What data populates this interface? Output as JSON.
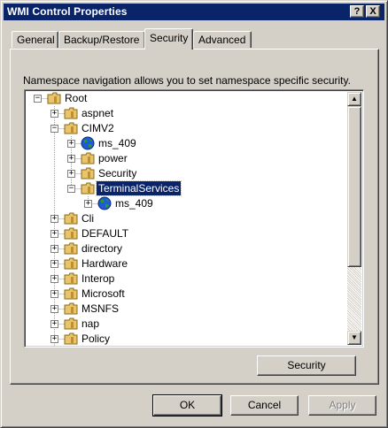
{
  "window": {
    "title": "WMI Control Properties",
    "help_label": "?",
    "close_label": "X"
  },
  "tabs": [
    {
      "label": "General",
      "active": false
    },
    {
      "label": "Backup/Restore",
      "active": false
    },
    {
      "label": "Security",
      "active": true
    },
    {
      "label": "Advanced",
      "active": false
    }
  ],
  "security_tab": {
    "description": "Namespace navigation allows you to set namespace specific security.",
    "security_button_label": "Security"
  },
  "tree": {
    "nodes": [
      {
        "label": "Root",
        "depth": 0,
        "state": "expanded",
        "icon": "folder-icon"
      },
      {
        "label": "aspnet",
        "depth": 1,
        "state": "collapsed",
        "icon": "folder-icon"
      },
      {
        "label": "CIMV2",
        "depth": 1,
        "state": "expanded",
        "icon": "folder-icon"
      },
      {
        "label": "ms_409",
        "depth": 2,
        "state": "collapsed",
        "icon": "globe-icon"
      },
      {
        "label": "power",
        "depth": 2,
        "state": "collapsed",
        "icon": "folder-icon"
      },
      {
        "label": "Security",
        "depth": 2,
        "state": "collapsed",
        "icon": "folder-icon"
      },
      {
        "label": "TerminalServices",
        "depth": 2,
        "state": "expanded",
        "icon": "folder-icon",
        "selected": true
      },
      {
        "label": "ms_409",
        "depth": 3,
        "state": "collapsed",
        "icon": "globe-icon"
      },
      {
        "label": "Cli",
        "depth": 1,
        "state": "collapsed",
        "icon": "folder-icon"
      },
      {
        "label": "DEFAULT",
        "depth": 1,
        "state": "collapsed",
        "icon": "folder-icon"
      },
      {
        "label": "directory",
        "depth": 1,
        "state": "collapsed",
        "icon": "folder-icon"
      },
      {
        "label": "Hardware",
        "depth": 1,
        "state": "collapsed",
        "icon": "folder-icon"
      },
      {
        "label": "Interop",
        "depth": 1,
        "state": "collapsed",
        "icon": "folder-icon"
      },
      {
        "label": "Microsoft",
        "depth": 1,
        "state": "collapsed",
        "icon": "folder-icon"
      },
      {
        "label": "MSNFS",
        "depth": 1,
        "state": "collapsed",
        "icon": "folder-icon"
      },
      {
        "label": "nap",
        "depth": 1,
        "state": "collapsed",
        "icon": "folder-icon"
      },
      {
        "label": "Policy",
        "depth": 1,
        "state": "collapsed",
        "icon": "folder-icon"
      }
    ]
  },
  "footer": {
    "ok_label": "OK",
    "cancel_label": "Cancel",
    "apply_label": "Apply"
  },
  "colors": {
    "titlebar": "#0a246a",
    "face": "#d4d0c8",
    "selection": "#0a246a",
    "folder": "#e8c46a",
    "globe_blue": "#1e5bd6",
    "globe_green": "#2a9a2a"
  }
}
